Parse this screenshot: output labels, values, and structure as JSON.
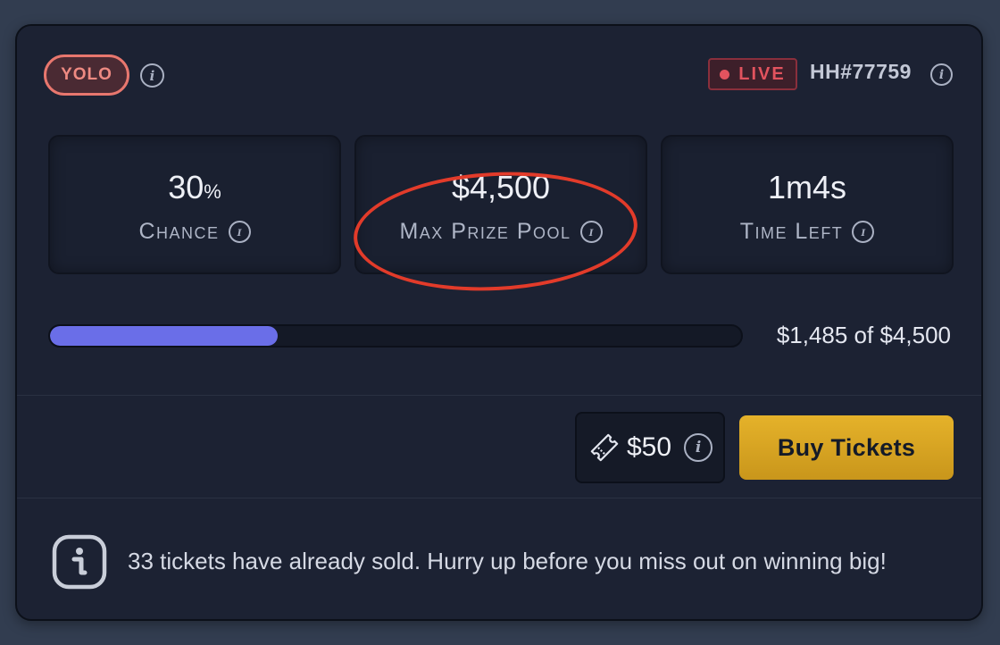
{
  "header": {
    "mode_badge": "YOLO",
    "live_label": "LIVE",
    "hand_id": "HH#77759",
    "info_glyph": "i"
  },
  "stats": [
    {
      "value": "30",
      "unit": "%",
      "label": "Chance"
    },
    {
      "value": "$4,500",
      "label": "Max Prize Pool"
    },
    {
      "value": "1m4s",
      "label": "Time Left"
    }
  ],
  "progress": {
    "current": 1485,
    "total": 4500,
    "fraction": 0.33,
    "text": "$1,485 of $4,500"
  },
  "purchase": {
    "ticket_price": "$50",
    "buy_label": "Buy Tickets"
  },
  "notice": {
    "text": "33 tickets have already sold. Hurry up before you miss out on winning big!"
  },
  "colors": {
    "accent": "#6a6ee8",
    "buy": "#e5b22a",
    "live": "#e2535e",
    "yolo": "#e8776e",
    "highlight": "#e23b2a"
  },
  "icons": [
    "info-icon",
    "ticket-icon",
    "live-dot-icon"
  ]
}
